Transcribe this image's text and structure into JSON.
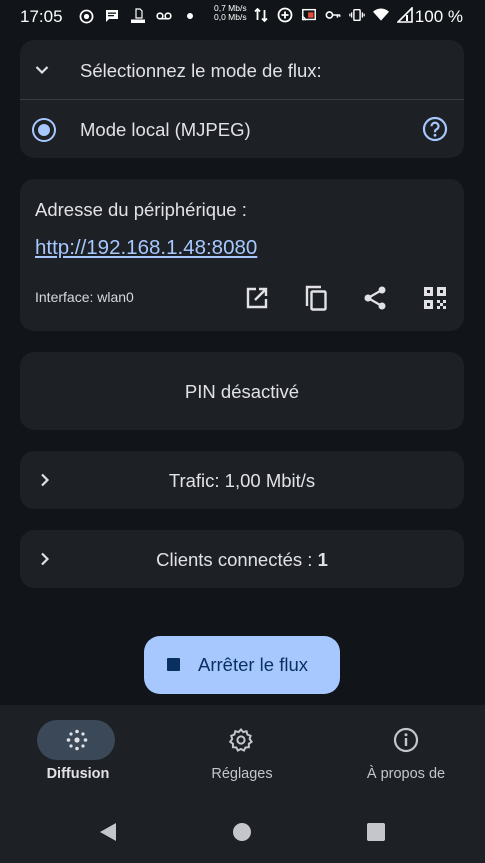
{
  "status_bar": {
    "time": "17:05",
    "net_up": "0,7 Mb/s",
    "net_down": "0,0 Mb/s",
    "battery": "100 %",
    "icons": [
      "record-icon",
      "message-icon",
      "http-icon",
      "voicemail-icon",
      "dot-icon",
      "data-arrows-icon",
      "cast-add-icon",
      "screencast-icon",
      "key-icon",
      "vibrate-icon",
      "wifi-icon",
      "signal-icon"
    ]
  },
  "mode_card": {
    "title": "Sélectionnez le mode de flux:",
    "selected_mode": "Mode local (MJPEG)",
    "icons": [
      "chevron-down-icon",
      "radio-selected-icon",
      "help-icon"
    ]
  },
  "address_card": {
    "title": "Adresse du périphérique :",
    "url": "http://192.168.1.48:8080",
    "interface": "Interface: wlan0",
    "actions": [
      "open-external-icon",
      "copy-icon",
      "share-icon",
      "qr-code-icon"
    ]
  },
  "pin_card": {
    "text": "PIN désactivé"
  },
  "traffic_card": {
    "text": "Trafic: 1,00 Mbit/s"
  },
  "clients_card": {
    "label": "Clients connectés : ",
    "count": "1"
  },
  "fab": {
    "label": "Arrêter le flux",
    "icon": "stop-icon"
  },
  "bottom_nav": {
    "items": [
      {
        "label": "Diffusion",
        "icon": "stream-icon",
        "active": true
      },
      {
        "label": "Réglages",
        "icon": "gear-icon",
        "active": false
      },
      {
        "label": "À propos de",
        "icon": "info-icon",
        "active": false
      }
    ]
  },
  "system_nav": [
    "back-icon",
    "home-icon",
    "recents-icon"
  ],
  "colors": {
    "background": "#111418",
    "card": "#1d2024",
    "accent": "#a6c8ff",
    "nav_pill": "#3b4858"
  }
}
